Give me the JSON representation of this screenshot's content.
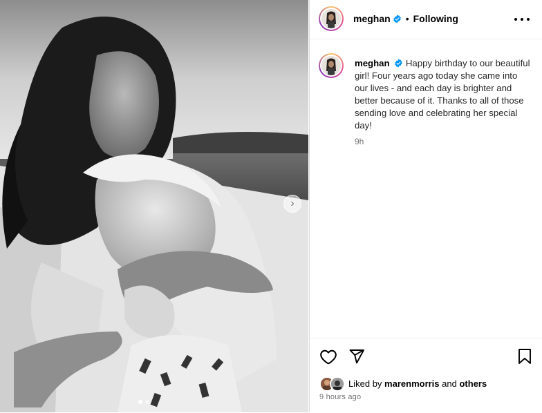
{
  "post": {
    "username": "meghan",
    "verified": true,
    "follow_status": "Following",
    "separator": "•",
    "caption": "Happy birthday to our beautiful girl! Four years ago today she came into our lives - and each day is brighter and better because of it. Thanks to all of those sending love and celebrating her special day!",
    "caption_time": "9h",
    "liked_by_prefix": "Liked by",
    "liked_by_user": "marenmorris",
    "liked_by_conjunction": "and",
    "liked_by_others": "others",
    "timestamp": "9 hours ago"
  },
  "media": {
    "description_icon": "photo",
    "next_icon": "chevron-right-icon",
    "carousel_count": 2,
    "carousel_active": 0
  },
  "icons": {
    "like": "heart-outline-icon",
    "share": "paper-plane-icon",
    "save": "bookmark-icon",
    "more": "more-horizontal-icon",
    "verified": "verified-badge-icon"
  },
  "colors": {
    "verified_blue": "#0095f6",
    "secondary_text": "#737373",
    "divider": "#efefef"
  }
}
